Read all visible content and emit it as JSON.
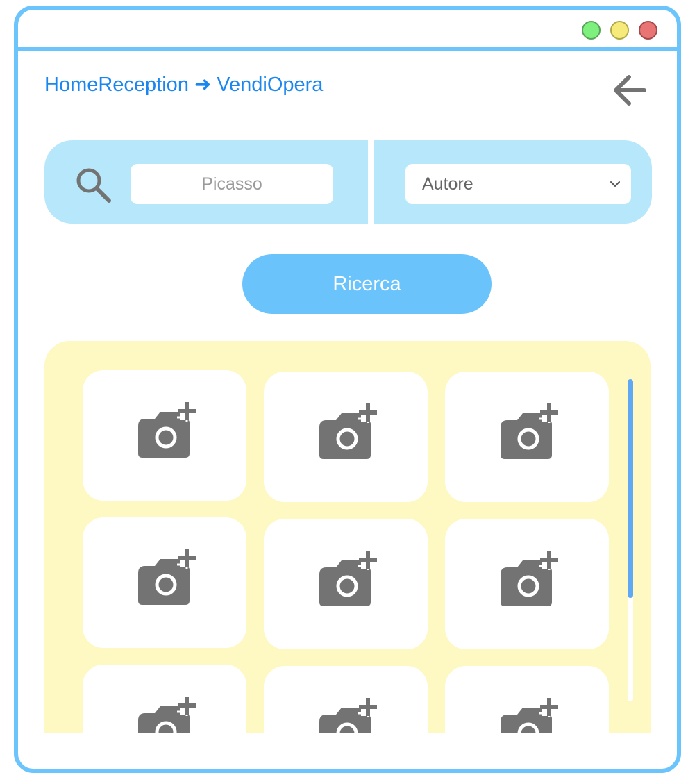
{
  "window": {
    "controls": [
      "green-button",
      "yellow-button",
      "red-button"
    ],
    "control_colors": [
      "#7ef07e",
      "#f6ea7a",
      "#e87474"
    ]
  },
  "breadcrumb": {
    "items": [
      "HomeReception",
      "VendiOpera"
    ],
    "separator": "➜"
  },
  "back_button": {
    "icon": "arrow-left-icon"
  },
  "search": {
    "icon": "search-icon",
    "placeholder": "Picasso",
    "value": "",
    "filter_selected": "Autore",
    "filter_icon": "chevron-down-icon"
  },
  "search_button": {
    "label": "Ricerca"
  },
  "gallery": {
    "tile_icon": "add-photo-icon",
    "tile_count": 9,
    "scroll_position": 0
  },
  "colors": {
    "accent": "#6cc4fc",
    "search_bg": "#b6e7fb",
    "button": "#6ac4fb",
    "gallery_bg": "#fef8c3",
    "link": "#1a86f0",
    "icon_gray": "#737373",
    "scroll_thumb": "#5fa8f5"
  }
}
